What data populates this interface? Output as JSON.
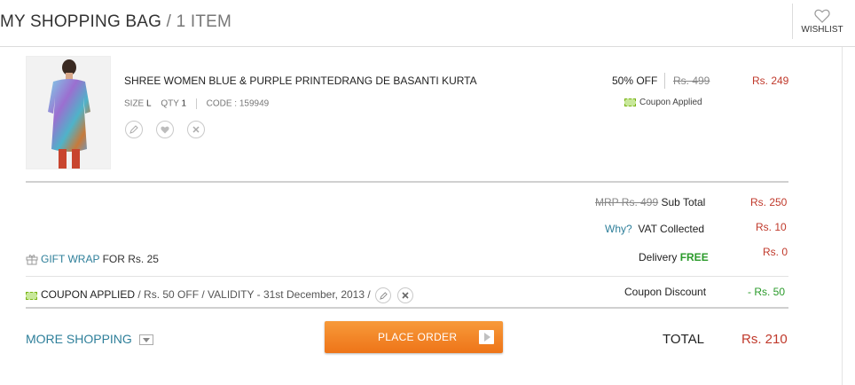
{
  "header": {
    "title": "MY SHOPPING BAG",
    "separator": "/",
    "item_count": "1 ITEM",
    "wishlist_label": "WISHLIST"
  },
  "item": {
    "name": "SHREE WOMEN BLUE & PURPLE PRINTEDRANG DE BASANTI KURTA",
    "size_label": "SIZE",
    "size": "L",
    "qty_label": "QTY",
    "qty": "1",
    "code_label": "CODE :",
    "code": "159949",
    "discount": "50% OFF",
    "mrp": "Rs. 499",
    "price": "Rs. 249",
    "coupon_status": "Coupon Applied",
    "icons": [
      "edit-icon",
      "heart-icon",
      "remove-icon"
    ]
  },
  "summary": {
    "mrp_struck": "MRP Rs. 499",
    "subtotal_label": "Sub Total",
    "subtotal_value": "Rs. 250",
    "why_link": "Why?",
    "vat_label": "VAT Collected",
    "vat_value": "Rs. 10",
    "delivery_label": "Delivery",
    "delivery_value": "FREE",
    "delivery_amount": "Rs. 0",
    "coupon_discount_label": "Coupon Discount",
    "coupon_discount_value": "- Rs. 50"
  },
  "gift_wrap": {
    "link": "GIFT WRAP",
    "text": "FOR Rs. 25"
  },
  "coupon": {
    "label": "COUPON APPLIED",
    "details": "/ Rs. 50 OFF / VALIDITY - 31st December, 2013 /"
  },
  "footer": {
    "more_shopping": "MORE SHOPPING",
    "place_order": "PLACE ORDER",
    "total_label": "TOTAL",
    "total_value": "Rs. 210"
  },
  "colors": {
    "price_red": "#c0392b",
    "link_teal": "#2e7f9a",
    "free_green": "#2a9a2a",
    "order_orange": "#ee7418"
  }
}
